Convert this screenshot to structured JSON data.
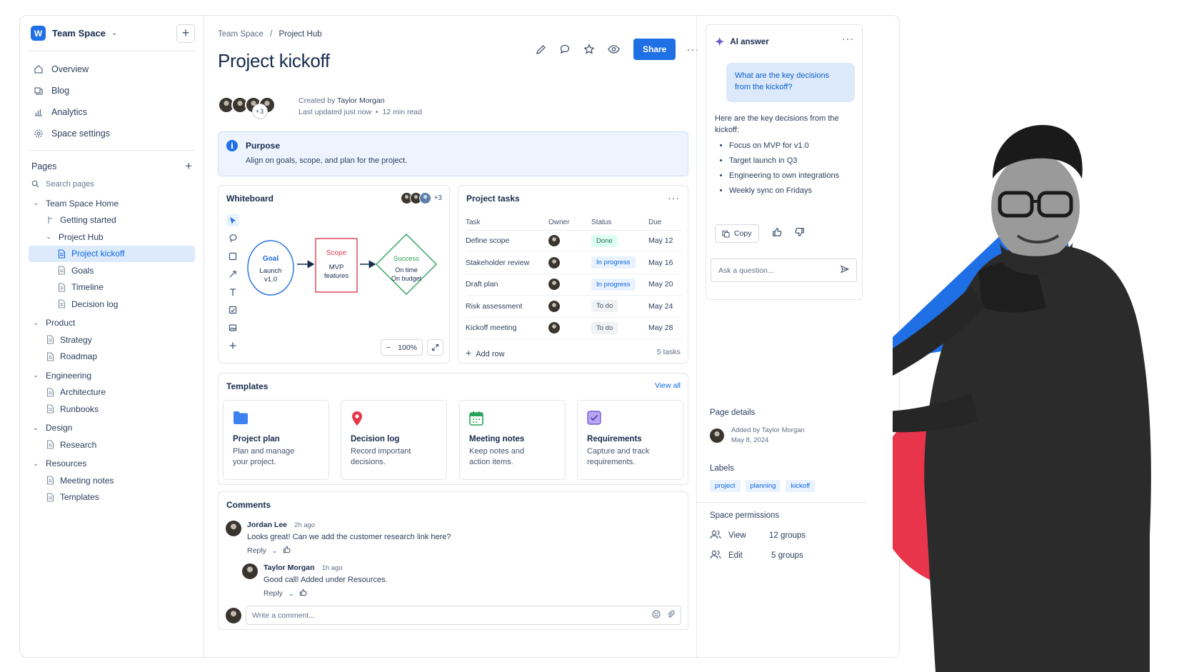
{
  "workspace": {
    "logo": "W",
    "name": "Team Space"
  },
  "nav": [
    {
      "label": "Overview",
      "icon": "home-icon"
    },
    {
      "label": "Blog",
      "icon": "blog-icon"
    },
    {
      "label": "Analytics",
      "icon": "analytics-icon"
    },
    {
      "label": "Space settings",
      "icon": "gear-icon"
    }
  ],
  "pages": {
    "heading": "Pages",
    "search_placeholder": "Search pages",
    "tree": {
      "home": "Team Space Home",
      "getting_started": "Getting started",
      "project_hub": "Project Hub",
      "project_kickoff": "Project kickoff",
      "goals": "Goals",
      "timeline": "Timeline",
      "decision_log": "Decision log",
      "product": "Product",
      "strategy": "Strategy",
      "roadmap": "Roadmap",
      "engineering": "Engineering",
      "architecture": "Architecture",
      "runbooks": "Runbooks",
      "design": "Design",
      "research": "Research",
      "resources": "Resources",
      "meeting_notes": "Meeting notes",
      "templates": "Templates"
    }
  },
  "breadcrumb": {
    "root": "Team Space",
    "sep": "/",
    "current": "Project Hub"
  },
  "page": {
    "title": "Project kickoff",
    "share": "Share",
    "more_avatars": "+3",
    "created_prefix": "Created by",
    "author": "Taylor Morgan",
    "updated": "Last updated just now",
    "dot": "•",
    "read_time": "12 min read"
  },
  "purpose": {
    "icon": "info-icon",
    "heading": "Purpose",
    "text": "Align on goals, scope, and plan for the project."
  },
  "whiteboard": {
    "title": "Whiteboard",
    "collab_more": "+3",
    "goal": {
      "title": "Goal",
      "l1": "Launch",
      "l2": "v1.0"
    },
    "scope": {
      "title": "Scope",
      "l1": "MVP",
      "l2": "features"
    },
    "success": {
      "title": "Success",
      "l1": "On time",
      "l2": "On budget"
    },
    "zoom": "100%",
    "zoom_minus": "−"
  },
  "tasks": {
    "title": "Project tasks",
    "columns": [
      "Task",
      "Owner",
      "Status",
      "Due"
    ],
    "rows": [
      {
        "task": "Define scope",
        "status": "Done",
        "kind": "done",
        "due": "May 12"
      },
      {
        "task": "Stakeholder review",
        "status": "In progress",
        "kind": "prog",
        "due": "May 16"
      },
      {
        "task": "Draft plan",
        "status": "In progress",
        "kind": "prog",
        "due": "May 20"
      },
      {
        "task": "Risk assessment",
        "status": "To do",
        "kind": "todo",
        "due": "May 24"
      },
      {
        "task": "Kickoff meeting",
        "status": "To do",
        "kind": "todo",
        "due": "May 28"
      }
    ],
    "add_row": "Add row",
    "count": "5 tasks"
  },
  "templates": {
    "title": "Templates",
    "view_all": "View all",
    "items": [
      {
        "name": "Project plan",
        "desc1": "Plan and manage",
        "desc2": "your project."
      },
      {
        "name": "Decision log",
        "desc1": "Record important",
        "desc2": "decisions."
      },
      {
        "name": "Meeting notes",
        "desc1": "Keep notes and",
        "desc2": "action items."
      },
      {
        "name": "Requirements",
        "desc1": "Capture and track",
        "desc2": "requirements."
      }
    ]
  },
  "comments": {
    "title": "Comments",
    "items": [
      {
        "author": "Jordan Lee",
        "time": "2h ago",
        "text": "Looks great! Can we add the customer research link here?",
        "reply": "Reply"
      },
      {
        "author": "Taylor Morgan",
        "time": "1h ago",
        "text": "Good call! Added under Resources.",
        "reply": "Reply"
      }
    ],
    "placeholder": "Write a comment..."
  },
  "ai": {
    "title": "AI answer",
    "question": "What are the key decisions from the kickoff?",
    "intro": "Here are the key decisions from the kickoff:",
    "bullets": [
      "Focus on MVP for v1.0",
      "Target launch in Q3",
      "Engineering to own integrations",
      "Weekly sync on Fridays"
    ],
    "copy": "Copy",
    "ask_placeholder": "Ask a question..."
  },
  "details": {
    "title": "Page details",
    "added_by": "Added by Taylor Morgan",
    "date": "May 8, 2024",
    "labels_title": "Labels",
    "labels": [
      "project",
      "planning",
      "kickoff"
    ],
    "perm_title": "Space permissions",
    "perms": [
      {
        "label": "View",
        "value": "12 groups"
      },
      {
        "label": "Edit",
        "value": "5 groups"
      }
    ]
  },
  "colors": {
    "accent": "#1f6fe5",
    "hero_blue": "#1f6fe5",
    "hero_red": "#e8354b",
    "scope_red": "#e23b55",
    "success_green": "#2aa35a"
  }
}
